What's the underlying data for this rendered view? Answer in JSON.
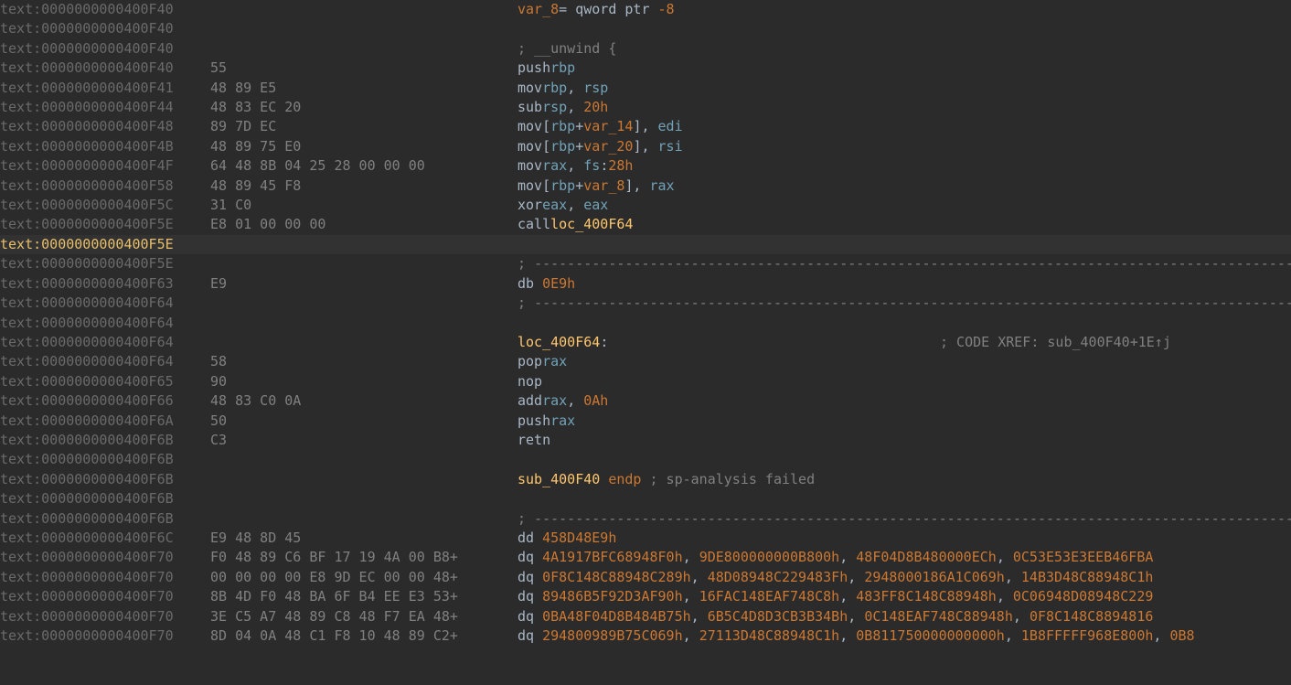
{
  "colors": {
    "bg": "#2b2b2b",
    "hlbg": "#323232",
    "addr": "#6a6a6a",
    "addrhl": "#e8bf6a",
    "bytes": "#808080",
    "normal": "#a9b7c6",
    "reg": "#72a2b7",
    "num": "#cc7832",
    "label": "#ffc66d",
    "comment": "#808080"
  },
  "lines": [
    {
      "addr": "text:0000000000400F40",
      "bytes": "",
      "rhs": [
        [
          "kw",
          "var_8"
        ],
        [
          "n",
          "= "
        ],
        [
          "n",
          "qword ptr "
        ],
        [
          "num",
          "-8"
        ]
      ]
    },
    {
      "addr": "text:0000000000400F40",
      "bytes": "",
      "rhs": []
    },
    {
      "addr": "text:0000000000400F40",
      "bytes": "",
      "rhs": [
        [
          "cmt",
          "; __unwind {"
        ]
      ]
    },
    {
      "addr": "text:0000000000400F40",
      "bytes": "55",
      "mn": "push",
      "ops": [
        [
          "reg",
          "rbp"
        ]
      ]
    },
    {
      "addr": "text:0000000000400F41",
      "bytes": "48 89 E5",
      "mn": "mov",
      "ops": [
        [
          "reg",
          "rbp"
        ],
        [
          "n",
          ", "
        ],
        [
          "reg",
          "rsp"
        ]
      ]
    },
    {
      "addr": "text:0000000000400F44",
      "bytes": "48 83 EC 20",
      "mn": "sub",
      "ops": [
        [
          "reg",
          "rsp"
        ],
        [
          "n",
          ", "
        ],
        [
          "num",
          "20h"
        ]
      ]
    },
    {
      "addr": "text:0000000000400F48",
      "bytes": "89 7D EC",
      "mn": "mov",
      "ops": [
        [
          "n",
          "["
        ],
        [
          "reg",
          "rbp"
        ],
        [
          "n",
          "+"
        ],
        [
          "kw",
          "var_14"
        ],
        [
          "n",
          "], "
        ],
        [
          "reg",
          "edi"
        ]
      ]
    },
    {
      "addr": "text:0000000000400F4B",
      "bytes": "48 89 75 E0",
      "mn": "mov",
      "ops": [
        [
          "n",
          "["
        ],
        [
          "reg",
          "rbp"
        ],
        [
          "n",
          "+"
        ],
        [
          "kw",
          "var_20"
        ],
        [
          "n",
          "], "
        ],
        [
          "reg",
          "rsi"
        ]
      ]
    },
    {
      "addr": "text:0000000000400F4F",
      "bytes": "64 48 8B 04 25 28 00 00 00",
      "mn": "mov",
      "ops": [
        [
          "reg",
          "rax"
        ],
        [
          "n",
          ", "
        ],
        [
          "reg",
          "fs"
        ],
        [
          "n",
          ":"
        ],
        [
          "num",
          "28h"
        ]
      ]
    },
    {
      "addr": "text:0000000000400F58",
      "bytes": "48 89 45 F8",
      "mn": "mov",
      "ops": [
        [
          "n",
          "["
        ],
        [
          "reg",
          "rbp"
        ],
        [
          "n",
          "+"
        ],
        [
          "kw",
          "var_8"
        ],
        [
          "n",
          "], "
        ],
        [
          "reg",
          "rax"
        ]
      ]
    },
    {
      "addr": "text:0000000000400F5C",
      "bytes": "31 C0",
      "mn": "xor",
      "ops": [
        [
          "reg",
          "eax"
        ],
        [
          "n",
          ", "
        ],
        [
          "reg",
          "eax"
        ]
      ]
    },
    {
      "addr": "text:0000000000400F5E",
      "bytes": "E8 01 00 00 00",
      "mn": "call",
      "ops": [
        [
          "lbl",
          "loc_400F64"
        ]
      ]
    },
    {
      "addr": "text:0000000000400F5E",
      "bytes": "",
      "rhs": [],
      "hl": true,
      "addrhl": true
    },
    {
      "addr": "text:0000000000400F5E",
      "bytes": "",
      "dashes": true
    },
    {
      "addr": "text:0000000000400F63",
      "bytes": "E9",
      "rhs": [
        [
          "n",
          "db "
        ],
        [
          "num",
          "0E9h"
        ]
      ]
    },
    {
      "addr": "text:0000000000400F64",
      "bytes": "",
      "dashes": true
    },
    {
      "addr": "text:0000000000400F64",
      "bytes": "",
      "rhs": []
    },
    {
      "addr": "text:0000000000400F64",
      "bytes": "",
      "rhs": [
        [
          "lbl",
          "loc_400F64"
        ],
        [
          "n",
          ":"
        ]
      ],
      "xref": "; CODE XREF: sub_400F40+1E↑j"
    },
    {
      "addr": "text:0000000000400F64",
      "bytes": "58",
      "mn": "pop",
      "ops": [
        [
          "reg",
          "rax"
        ]
      ]
    },
    {
      "addr": "text:0000000000400F65",
      "bytes": "90",
      "mn": "nop",
      "ops": []
    },
    {
      "addr": "text:0000000000400F66",
      "bytes": "48 83 C0 0A",
      "mn": "add",
      "ops": [
        [
          "reg",
          "rax"
        ],
        [
          "n",
          ", "
        ],
        [
          "num",
          "0Ah"
        ]
      ]
    },
    {
      "addr": "text:0000000000400F6A",
      "bytes": "50",
      "mn": "push",
      "ops": [
        [
          "reg",
          "rax"
        ]
      ]
    },
    {
      "addr": "text:0000000000400F6B",
      "bytes": "C3",
      "mn": "retn",
      "ops": []
    },
    {
      "addr": "text:0000000000400F6B",
      "bytes": "",
      "rhs": []
    },
    {
      "addr": "text:0000000000400F6B",
      "bytes": "",
      "rhs": [
        [
          "lbl",
          "sub_400F40"
        ],
        [
          "n",
          " "
        ],
        [
          "kw",
          "endp"
        ],
        [
          "n",
          " "
        ],
        [
          "cmt",
          "; sp-analysis failed"
        ]
      ]
    },
    {
      "addr": "text:0000000000400F6B",
      "bytes": "",
      "rhs": []
    },
    {
      "addr": "text:0000000000400F6B",
      "bytes": "",
      "dashes": true
    },
    {
      "addr": "text:0000000000400F6C",
      "bytes": "E9 48 8D 45",
      "rhs": [
        [
          "n",
          "dd "
        ],
        [
          "num",
          "458D48E9h"
        ]
      ]
    },
    {
      "addr": "text:0000000000400F70",
      "bytes": "F0 48 89 C6 BF 17 19 4A 00 B8+",
      "dq": [
        "4A1917BFC68948F0h",
        "9DE800000000B800h",
        "48F04D8B480000ECh",
        "0C53E53E3EEB46FBA"
      ]
    },
    {
      "addr": "text:0000000000400F70",
      "bytes": "00 00 00 00 E8 9D EC 00 00 48+",
      "dq": [
        "0F8C148C88948C289h",
        "48D08948C229483Fh",
        "2948000186A1C069h",
        "14B3D48C88948C1h"
      ]
    },
    {
      "addr": "text:0000000000400F70",
      "bytes": "8B 4D F0 48 BA 6F B4 EE E3 53+",
      "dq": [
        "89486B5F92D3AF90h",
        "16FAC148EAF748C8h",
        "483FF8C148C88948h",
        "0C06948D08948C229"
      ]
    },
    {
      "addr": "text:0000000000400F70",
      "bytes": "3E C5 A7 48 89 C8 48 F7 EA 48+",
      "dq": [
        "0BA48F04D8B484B75h",
        "6B5C4D8D3CB3B34Bh",
        "0C148EAF748C88948h",
        "0F8C148C8894816"
      ]
    },
    {
      "addr": "text:0000000000400F70",
      "bytes": "8D 04 0A 48 C1 F8 10 48 89 C2+",
      "dq": [
        "294800989B75C069h",
        "27113D48C88948C1h",
        "0B811750000000000h",
        "1B8FFFFF968E800h",
        "0B8"
      ]
    }
  ]
}
